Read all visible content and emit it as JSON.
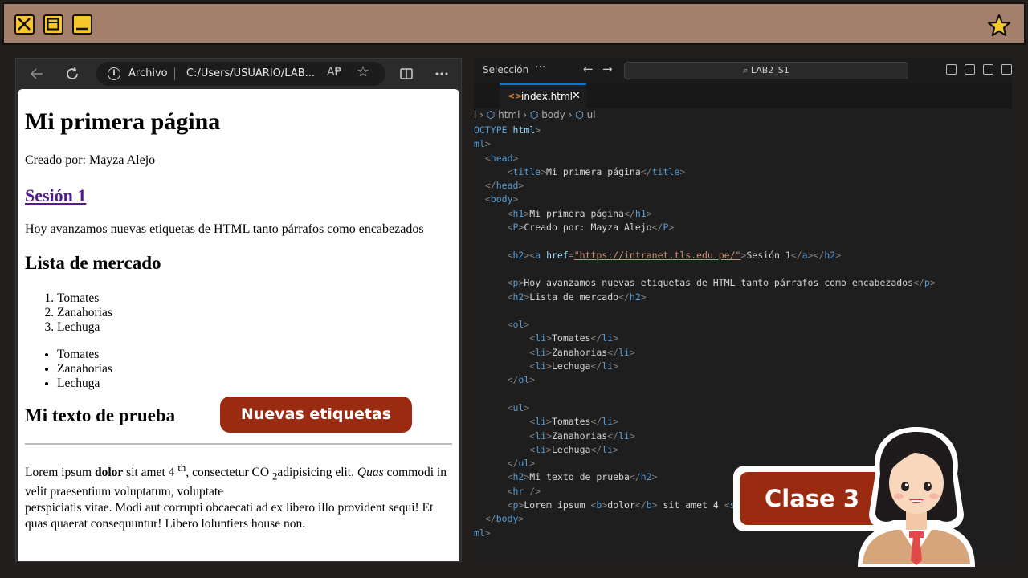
{
  "browser": {
    "address_origin": "Archivo",
    "address_url": "C:/Users/USUARIO/LAB...",
    "reader_icon": "A₱"
  },
  "page": {
    "h1": "Mi primera página",
    "created_by": "Creado por: Mayza Alejo",
    "session_link": "Sesión 1",
    "intro": "Hoy avanzamos nuevas etiquetas de HTML tanto párrafos como encabezados",
    "market_title": "Lista de mercado",
    "ordered": [
      "Tomates",
      "Zanahorias",
      "Lechuga"
    ],
    "unordered": [
      "Tomates",
      "Zanahorias",
      "Lechuga"
    ],
    "test_title": "Mi texto de prueba",
    "lorem": {
      "a": "Lorem ipsum ",
      "b": "dolor",
      "c": " sit amet 4 ",
      "sup": "th",
      "d": ", consectetur CO ",
      "sub": "2",
      "e": "adipisicing elit. ",
      "em": "Quas",
      "f": " commodi in velit praesentium voluptatum, voluptate",
      "g": "perspiciatis vitae. Modi aut corrupti obcaecati ad ex libero illo provident sequi! Et quas quaerat consequuntur! Libero loluntiers house non."
    }
  },
  "vscode": {
    "menu_label": "Selección",
    "search": "LAB2_S1",
    "tab_name": "index.html",
    "crumbs": [
      "html",
      "body",
      "ul"
    ]
  },
  "badges": {
    "new_tags": "Nuevas etiquetas",
    "class": "Clase 3"
  },
  "colors": {
    "frame": "#a4806c",
    "accent": "#9a2b10",
    "window_button": "#f5c72a"
  }
}
